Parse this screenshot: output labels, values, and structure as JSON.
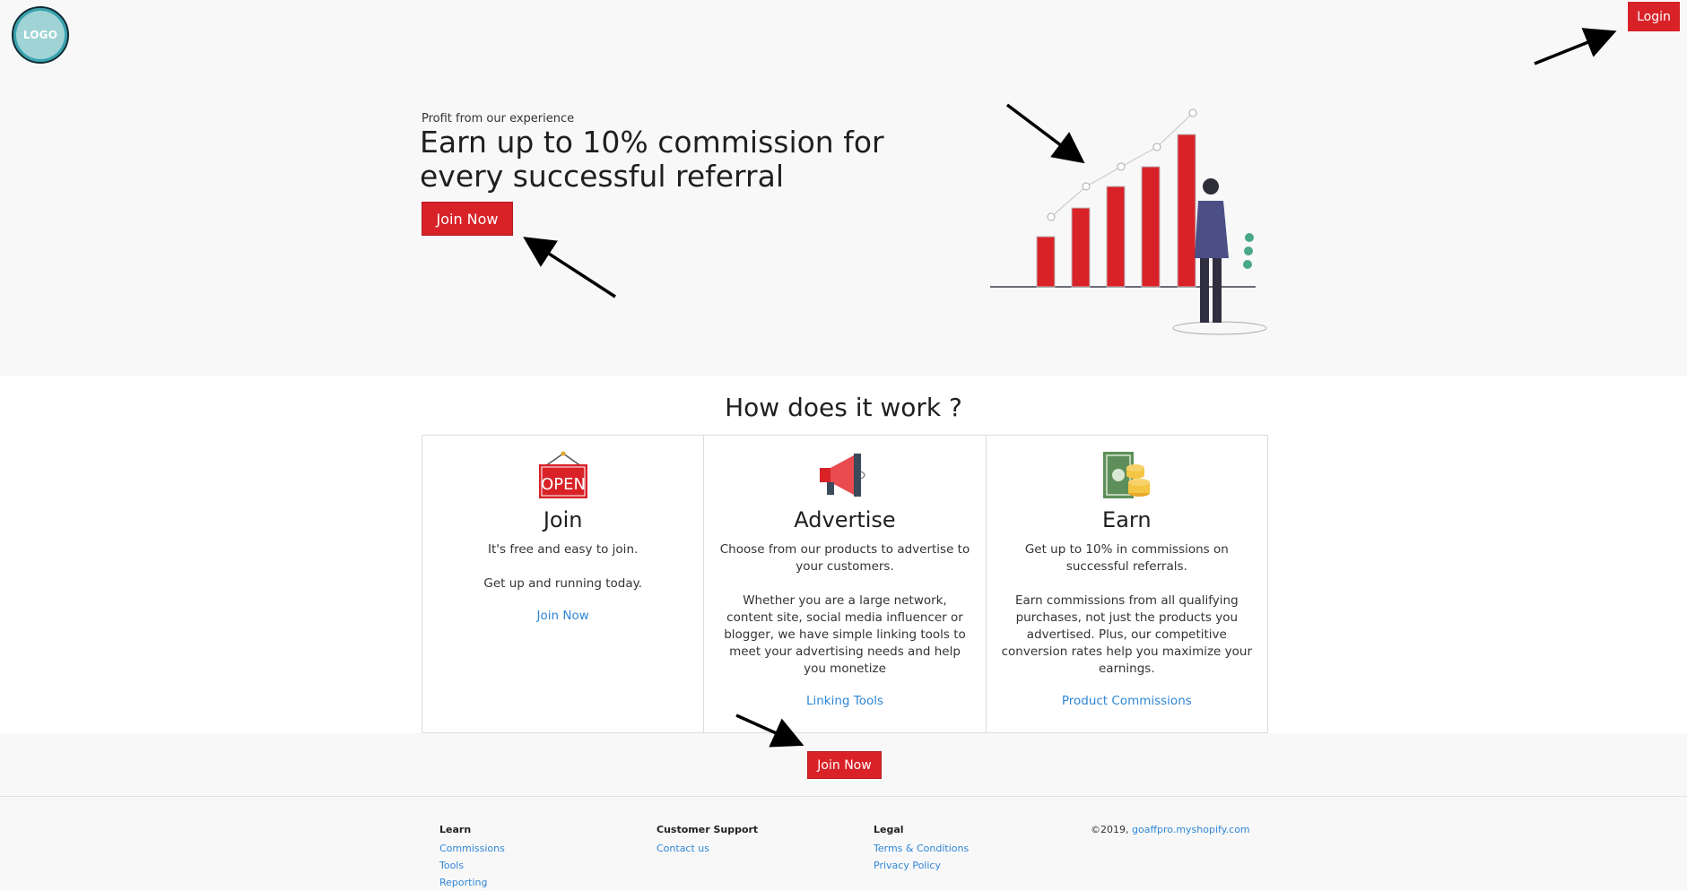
{
  "header": {
    "logo_text": "LOGO",
    "login_label": "Login"
  },
  "hero": {
    "eyebrow": "Profit from our experience",
    "title": "Earn up to 10% commission for every successful referral",
    "join_label": "Join Now"
  },
  "how": {
    "title": "How does it work ?",
    "cards": [
      {
        "icon": "open-sign-icon",
        "title": "Join",
        "text": "It's free and easy to join.\n\nGet up and running today.",
        "link": "Join Now"
      },
      {
        "icon": "megaphone-icon",
        "title": "Advertise",
        "text": "Choose from our products to advertise to your customers.\n\nWhether you are a large network, content site, social media influencer or blogger, we have simple linking tools to meet your advertising needs and help you monetize",
        "link": "Linking Tools"
      },
      {
        "icon": "money-coins-icon",
        "title": "Earn",
        "text": "Get up to 10% in commissions on successful referrals.\n\nEarn commissions from all qualifying purchases, not just the products you advertised. Plus, our competitive conversion rates help you maximize your earnings.",
        "link": "Product Commissions"
      }
    ]
  },
  "cta": {
    "join_label": "Join Now"
  },
  "footer": {
    "learn": {
      "heading": "Learn",
      "links": [
        "Commissions",
        "Tools",
        "Reporting"
      ]
    },
    "support": {
      "heading": "Customer Support",
      "links": [
        "Contact us"
      ]
    },
    "legal": {
      "heading": "Legal",
      "links": [
        "Terms & Conditions",
        "Privacy Policy"
      ]
    },
    "copyright_prefix": "©2019,",
    "copyright_link": "goaffpro.myshopify.com"
  },
  "colors": {
    "accent": "#d82228",
    "link": "#2f86d6"
  },
  "illustration": {
    "icon": "growth-chart-person-icon"
  }
}
